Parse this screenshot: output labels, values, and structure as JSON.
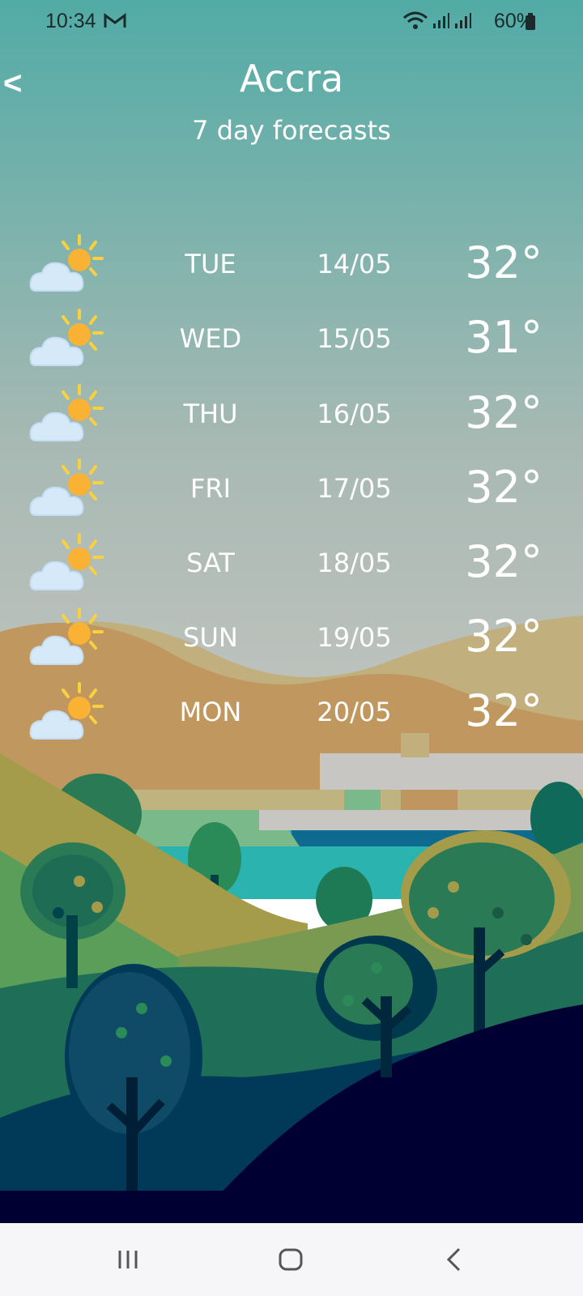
{
  "status_bar": {
    "time": "10:34",
    "battery": "60%"
  },
  "header": {
    "back_label": "<",
    "city": "Accra",
    "subtitle": "7 day forecasts"
  },
  "forecast": [
    {
      "day": "TUE",
      "date": "14/05",
      "temp": "32°",
      "icon": "partly-cloudy-icon"
    },
    {
      "day": "WED",
      "date": "15/05",
      "temp": "31°",
      "icon": "partly-cloudy-icon"
    },
    {
      "day": "THU",
      "date": "16/05",
      "temp": "32°",
      "icon": "partly-cloudy-icon"
    },
    {
      "day": "FRI",
      "date": "17/05",
      "temp": "32°",
      "icon": "partly-cloudy-icon"
    },
    {
      "day": "SAT",
      "date": "18/05",
      "temp": "32°",
      "icon": "partly-cloudy-icon"
    },
    {
      "day": "SUN",
      "date": "19/05",
      "temp": "32°",
      "icon": "partly-cloudy-icon"
    },
    {
      "day": "MON",
      "date": "20/05",
      "temp": "32°",
      "icon": "partly-cloudy-icon"
    }
  ],
  "colors": {
    "sky_top": "#52aba6",
    "sky_bottom": "#c6c6c6",
    "text": "#ffffff",
    "sun": "#f9b233",
    "cloud": "#d6e9f8"
  }
}
